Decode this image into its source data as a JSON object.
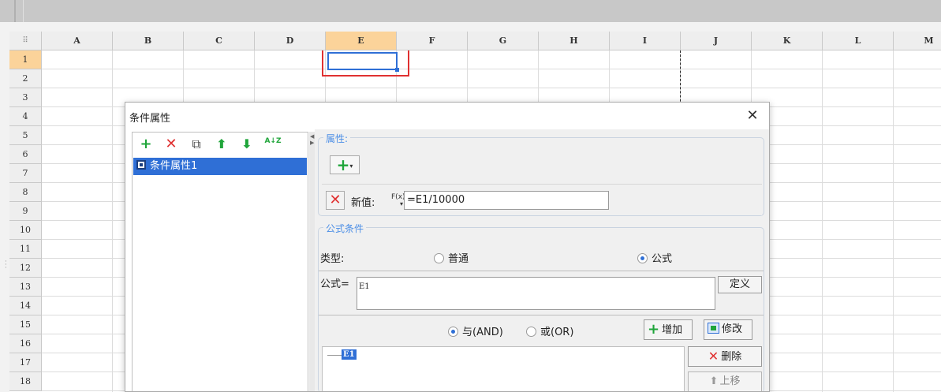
{
  "spreadsheet": {
    "corner_glyph": "⠿",
    "columns": [
      "A",
      "B",
      "C",
      "D",
      "E",
      "F",
      "G",
      "H",
      "I",
      "J",
      "K",
      "L",
      "M"
    ],
    "active_column": "E",
    "rows": [
      "1",
      "2",
      "3",
      "4",
      "5",
      "6",
      "7",
      "8",
      "9",
      "10",
      "11",
      "12",
      "13",
      "14",
      "15",
      "16",
      "17",
      "18"
    ],
    "active_row": "1",
    "selected_cell": "E1"
  },
  "dialog": {
    "title": "条件属性",
    "close_glyph": "✕",
    "left_toolbar": {
      "add_glyph": "+",
      "delete_glyph": "✕",
      "copy_glyph": "⧉",
      "up_glyph": "⬆",
      "down_glyph": "⬇",
      "sort_glyph": "A↓Z"
    },
    "list_items": [
      "条件属性1"
    ],
    "attributes": {
      "legend": "属性:",
      "add_glyph": "+",
      "dropdown_glyph": "▾",
      "delete_glyph": "✕",
      "new_value_label": "新值:",
      "fx_label": "F(x)",
      "new_value": "=E1/10000"
    },
    "formula_condition": {
      "legend": "公式条件",
      "type_label": "类型:",
      "option_normal": "普通",
      "option_formula": "公式",
      "selected_type": "公式",
      "formula_label": "公式=",
      "formula_value": "E1",
      "define_button": "定义",
      "and_label": "与(AND)",
      "or_label": "或(OR)",
      "selected_logic": "与(AND)",
      "add_button": "增加",
      "edit_button": "修改",
      "tree_node": "E1",
      "remove_button": "删除",
      "move_up_button": "上移"
    }
  },
  "colors": {
    "selection_blue": "#2f6fd6",
    "highlight_red": "#e03131",
    "active_header": "#fbd39a",
    "add_green": "#1fa53a",
    "legend_blue": "#4b8ee6"
  }
}
